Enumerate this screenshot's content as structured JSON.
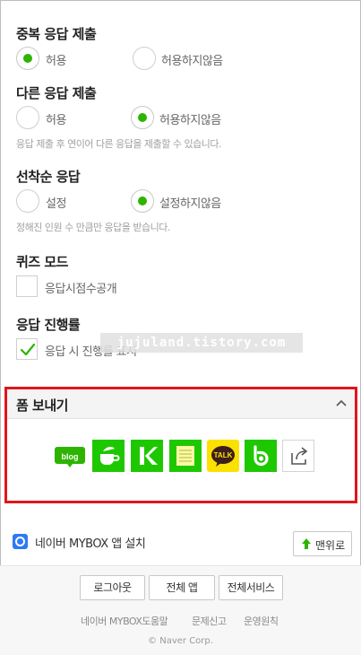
{
  "settings": {
    "duplicate": {
      "title": "중복 응답 제출",
      "options": [
        "허용",
        "허용하지않음"
      ],
      "selected_index": 0
    },
    "different": {
      "title": "다른 응답 제출",
      "options": [
        "허용",
        "허용하지않음"
      ],
      "selected_index": 1,
      "help": "응답 제출 후 연이어 다른 응답을 제출할 수 있습니다."
    },
    "first_come": {
      "title": "선착순 응답",
      "options": [
        "설정",
        "설정하지않음"
      ],
      "selected_index": 1,
      "help": "정해진 인원 수 만큼만 응답을 받습니다."
    },
    "quiz": {
      "title": "퀴즈 모드",
      "checkbox_label": "응답시점수공개",
      "checked": false
    },
    "progress": {
      "title": "응답 진행률",
      "checkbox_label": "응답 시 진행률 표시",
      "checked": true
    }
  },
  "watermark": "jujuland.tistory.com",
  "share": {
    "title": "폼 보내기",
    "icons": [
      {
        "name": "naver-blog-icon",
        "text": "blog",
        "color": "#2db400"
      },
      {
        "name": "naver-cafe-icon",
        "color": "#1ec800"
      },
      {
        "name": "naver-keep-icon",
        "color": "#1ec800"
      },
      {
        "name": "naver-memo-icon",
        "color": "#1ec800"
      },
      {
        "name": "kakaotalk-icon",
        "text": "TALK",
        "color": "#fae100"
      },
      {
        "name": "naver-band-icon",
        "color": "#1ec800"
      },
      {
        "name": "external-share-icon",
        "color": "#666666"
      }
    ]
  },
  "footer": {
    "mybox_label": "네이버 MYBOX 앱 설치",
    "top_button": "맨위로",
    "buttons": [
      "로그아웃",
      "전체 앱",
      "전체서비스"
    ],
    "links": [
      "네이버 MYBOX도움말",
      "문제신고",
      "운영원칙"
    ],
    "copyright": "© Naver Corp."
  },
  "colors": {
    "accent_green": "#2db400",
    "highlight_red": "#e0161e"
  }
}
